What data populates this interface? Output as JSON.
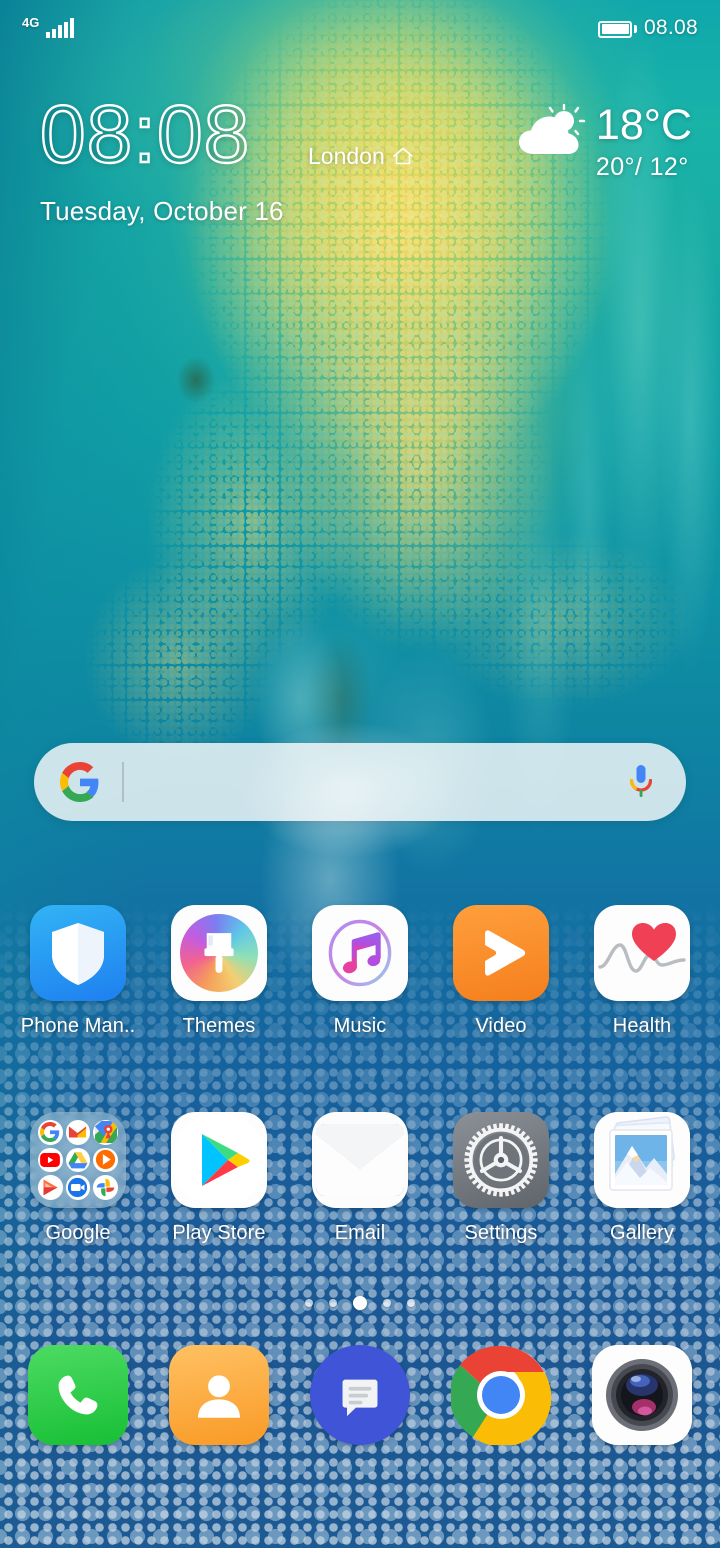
{
  "status_bar": {
    "network_type": "4G",
    "signal_icon": "signal-bars-icon",
    "signal_strength_bars": 5,
    "battery_icon": "battery-full-icon",
    "clock": "08.08"
  },
  "clock_widget": {
    "time": "08:08",
    "city": "London",
    "home_icon": "home-icon",
    "date": "Tuesday, October 16"
  },
  "weather_widget": {
    "condition_icon": "partly-cloudy-icon",
    "current_temp": "18°C",
    "high_low": "20°/ 12°"
  },
  "search_bar": {
    "logo_icon": "google-g-icon",
    "placeholder": "",
    "value": "",
    "mic_icon": "microphone-icon"
  },
  "app_rows": [
    {
      "apps": [
        {
          "label": "Phone Man..",
          "icon": "phone-manager-icon"
        },
        {
          "label": "Themes",
          "icon": "themes-icon"
        },
        {
          "label": "Music",
          "icon": "music-icon"
        },
        {
          "label": "Video",
          "icon": "video-icon"
        },
        {
          "label": "Health",
          "icon": "health-icon"
        }
      ]
    },
    {
      "apps": [
        {
          "label": "Google",
          "icon": "google-folder-icon"
        },
        {
          "label": "Play Store",
          "icon": "play-store-icon"
        },
        {
          "label": "Email",
          "icon": "email-icon"
        },
        {
          "label": "Settings",
          "icon": "settings-icon"
        },
        {
          "label": "Gallery",
          "icon": "gallery-icon"
        }
      ]
    }
  ],
  "google_folder_contents": [
    "google-search-icon",
    "gmail-icon",
    "google-maps-icon",
    "youtube-icon",
    "google-drive-icon",
    "play-music-icon",
    "play-movies-icon",
    "google-duo-icon",
    "google-photos-icon"
  ],
  "page_indicator": {
    "total_pages": 5,
    "current_page": 3
  },
  "dock": [
    {
      "name": "Phone",
      "icon": "phone-dialer-icon"
    },
    {
      "name": "Contacts",
      "icon": "contacts-icon"
    },
    {
      "name": "Messages",
      "icon": "messages-icon"
    },
    {
      "name": "Chrome",
      "icon": "chrome-icon"
    },
    {
      "name": "Camera",
      "icon": "camera-icon"
    }
  ],
  "colors": {
    "wallpaper_teal": "#11a0a6",
    "wallpaper_blue": "#1a5b98",
    "wallpaper_gold": "#e8d45c",
    "text_on_wallpaper": "#ffffff",
    "search_bar_bg": "#fcfdfc",
    "phone_manager_blue": "#1e7ff0",
    "video_orange": "#f47f1c",
    "health_red": "#ef4056",
    "settings_gray": "#5f646b",
    "phone_green": "#17bf35",
    "contacts_orange": "#f99a26",
    "messages_blue": "#4054d8"
  }
}
